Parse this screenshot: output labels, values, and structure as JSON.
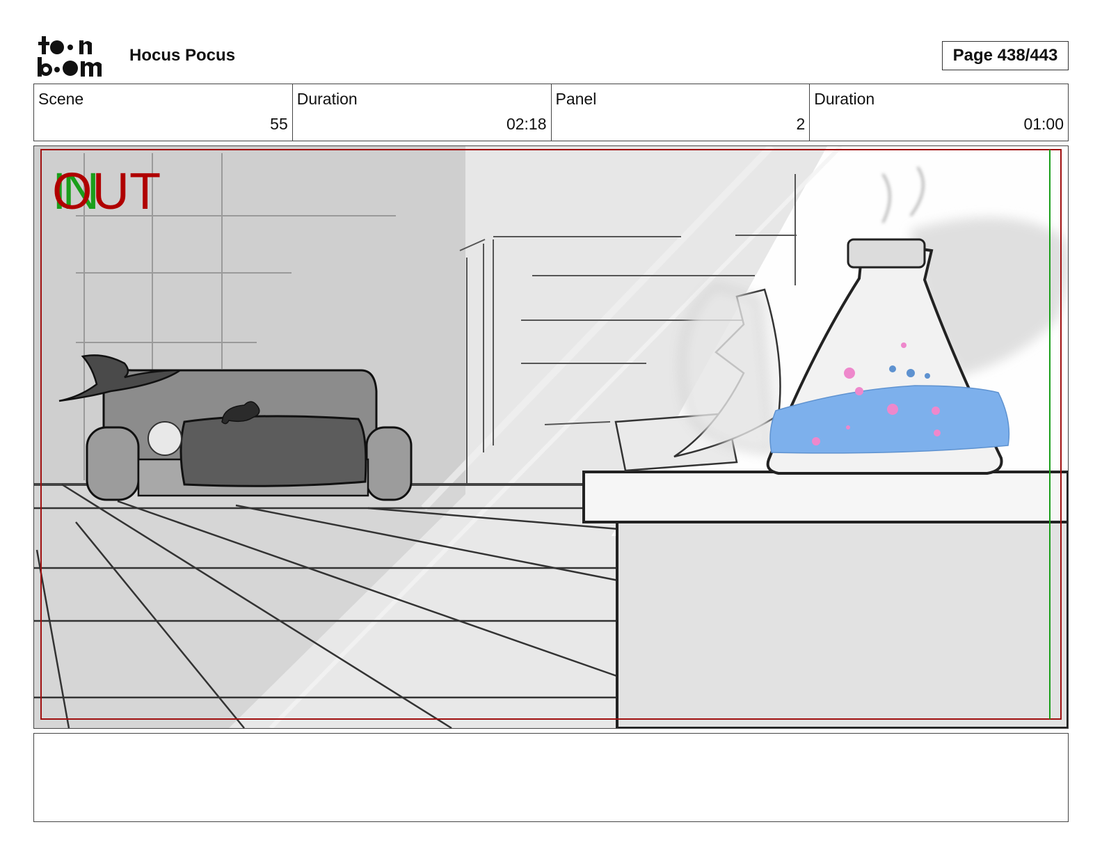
{
  "header": {
    "logo_text": "toon boom",
    "project_title": "Hocus Pocus",
    "page_label": "Page 438/443"
  },
  "info": {
    "scene_label": "Scene",
    "scene_value": "55",
    "scene_duration_label": "Duration",
    "scene_duration_value": "02:18",
    "panel_label": "Panel",
    "panel_value": "2",
    "panel_duration_label": "Duration",
    "panel_duration_value": "01:00"
  },
  "panel": {
    "marker_in": "IN",
    "marker_out": "OUT",
    "colors": {
      "in_marker": "#1a9e1a",
      "out_marker": "#b00000",
      "frame_border": "#a01010",
      "potion": "#7db0ec",
      "bubbles": "#ee88cc"
    }
  },
  "notes": {
    "text": ""
  }
}
